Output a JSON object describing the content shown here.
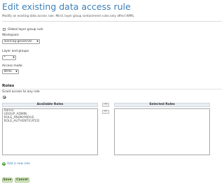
{
  "header": {
    "title": "Edit existing data access rule",
    "subtitle": "Modify an existing data access rule. Mind, layer group containment rules only affect WMS."
  },
  "form": {
    "global_layer_group_rule_label": "Global layer group rule",
    "global_layer_group_rule_checked": false,
    "workspace_label": "Workspace",
    "workspace_value": "learning-geoserver",
    "layer_label": "Layer and groups",
    "layer_value": "*",
    "access_mode_label": "Access mode",
    "access_mode_value": "Write"
  },
  "roles": {
    "section_title": "Roles",
    "grant_any_label": "Grant access to any role",
    "grant_any_checked": true,
    "available_header": "Available Roles",
    "selected_header": "Selected Roles",
    "available": [
      "Admin",
      "GROUP_ADMIN",
      "ROLE_ANONYMOUS",
      "ROLE_AUTHENTICATED"
    ],
    "selected": [],
    "move_right_label": "⇒",
    "move_left_label": "⇐",
    "add_new_role_label": "Add a new role"
  },
  "buttons": {
    "save_label": "Save",
    "cancel_label": "Cancel"
  },
  "colors": {
    "title": "#3d7fb8",
    "button_bg": "#d9ebc4",
    "add_icon": "#4aa03a"
  }
}
